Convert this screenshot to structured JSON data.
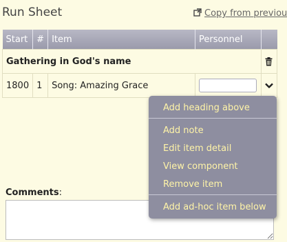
{
  "page": {
    "title": "Run Sheet",
    "copy_link_label": "Copy from previous"
  },
  "table": {
    "headers": [
      "Start",
      "#",
      "Item",
      "Personnel"
    ],
    "heading_row": {
      "label": "Gathering in God's name"
    },
    "item_row": {
      "start": "1800",
      "num": "1",
      "item": "Song: Amazing Grace",
      "personnel_value": ""
    }
  },
  "comments": {
    "label": "Comments",
    "suffix": ":",
    "value": ""
  },
  "menu": {
    "items": [
      "Add heading above",
      "Add note",
      "Edit item detail",
      "View component",
      "Remove item",
      "Add ad-hoc item below"
    ]
  },
  "icons": {
    "copy": "external-copy-icon",
    "trash": "trash-icon",
    "chevron": "chevron-down-icon"
  },
  "colors": {
    "background": "#fdfbe3",
    "header": "#a5a5b6",
    "menu_bg": "#8e8ea0",
    "menu_text": "#fff4a8"
  }
}
